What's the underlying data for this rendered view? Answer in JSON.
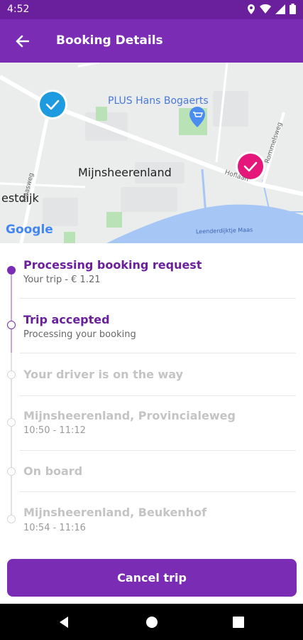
{
  "status_bar": {
    "time": "4:52"
  },
  "app_bar": {
    "title": "Booking Details"
  },
  "map": {
    "labels": {
      "store": "PLUS Hans Bogaerts",
      "town": "Mijnsheerenland",
      "west_town": "estdijk",
      "street_left": "Maasweg",
      "street_right": "Hofláan",
      "street_far_right": "Rommelsweg",
      "water": "Leenderdijktje Maas",
      "brand": "Google"
    },
    "colors": {
      "pickup_marker": "#1e9be0",
      "dropoff_marker": "#e6177a",
      "water": "#a6c6f5",
      "park": "#b9e2b6"
    }
  },
  "steps": [
    {
      "title": "Processing booking request",
      "subtitle": "Your trip - € 1.21",
      "state": "done"
    },
    {
      "title": "Trip accepted",
      "subtitle": "Processing your booking",
      "state": "current"
    },
    {
      "title": "Your driver is on the way",
      "subtitle": "",
      "state": "pending"
    },
    {
      "title": "Mijnsheerenland, Provincialeweg",
      "subtitle": "10:50 - 11:12",
      "state": "pending"
    },
    {
      "title": "On board",
      "subtitle": "",
      "state": "pending"
    },
    {
      "title": "Mijnsheerenland, Beukenhof",
      "subtitle": "10:54 - 11:16",
      "state": "pending"
    }
  ],
  "actions": {
    "cancel_label": "Cancel trip"
  },
  "theme": {
    "primary": "#7b2cb4",
    "status_bar": "#6a1f9c"
  }
}
